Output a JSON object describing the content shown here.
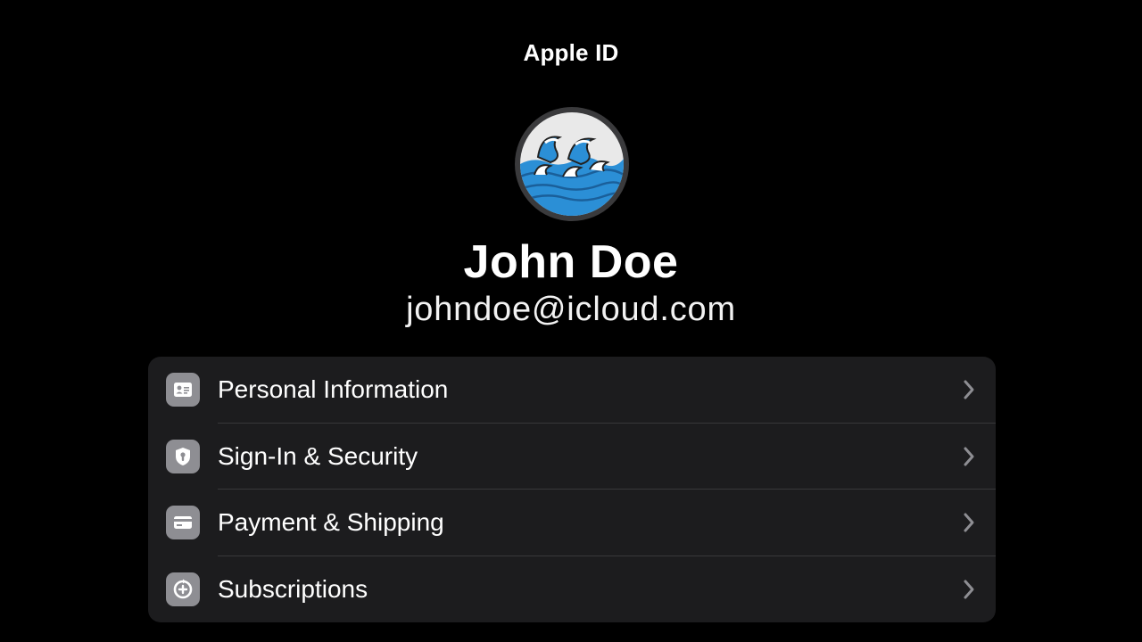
{
  "header": {
    "title": "Apple ID"
  },
  "profile": {
    "name": "John Doe",
    "email": "johndoe@icloud.com",
    "avatar_icon": "ocean-waves-avatar"
  },
  "menu": {
    "items": [
      {
        "label": "Personal Information",
        "icon": "id-card-icon"
      },
      {
        "label": "Sign-In & Security",
        "icon": "shield-icon"
      },
      {
        "label": "Payment & Shipping",
        "icon": "credit-card-icon"
      },
      {
        "label": "Subscriptions",
        "icon": "subscriptions-icon"
      }
    ]
  },
  "colors": {
    "background": "#000000",
    "group_background": "#1c1c1e",
    "icon_tile": "#8e8e93",
    "chevron": "#8e8e93",
    "text": "#ffffff"
  }
}
